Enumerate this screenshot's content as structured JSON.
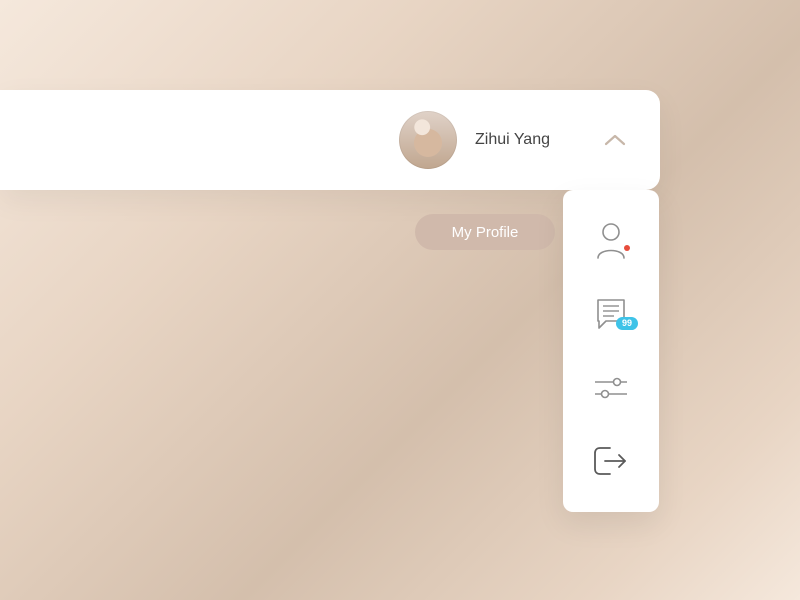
{
  "header": {
    "username": "Zihui Yang"
  },
  "tooltip": {
    "label": "My Profile"
  },
  "menu": {
    "messages_badge": "99"
  }
}
